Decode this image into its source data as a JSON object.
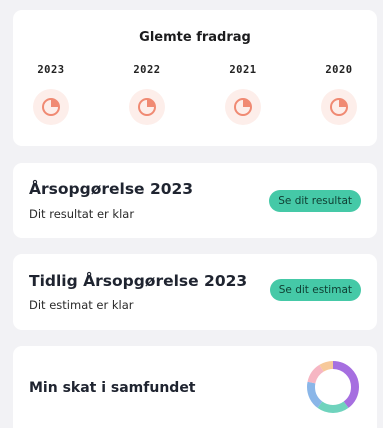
{
  "forgotten_deductions": {
    "title": "Glemte fradrag",
    "years": [
      {
        "label": "2023",
        "icon": "pie-chart-icon"
      },
      {
        "label": "2022",
        "icon": "pie-chart-icon"
      },
      {
        "label": "2021",
        "icon": "pie-chart-icon"
      },
      {
        "label": "2020",
        "icon": "pie-chart-icon"
      }
    ]
  },
  "annual_statement": {
    "title": "Årsopgørelse 2023",
    "subtitle": "Dit resultat er klar",
    "button_label": "Se dit resultat"
  },
  "early_statement": {
    "title": "Tidlig Årsopgørelse 2023",
    "subtitle": "Dit estimat er klar",
    "button_label": "Se dit estimat"
  },
  "tax_in_society": {
    "title": "Min skat i samfundet",
    "icon": "donut-chart-icon"
  },
  "colors": {
    "background": "#f2f2f5",
    "card": "#ffffff",
    "accent_green": "#45c9a7",
    "pie_icon": "#f08a73",
    "pie_icon_bg": "#fdeeea",
    "donut_segments": [
      "#a66fe0",
      "#6fd3bd",
      "#8ab6e8",
      "#f6b6c3",
      "#f7c99a"
    ]
  }
}
